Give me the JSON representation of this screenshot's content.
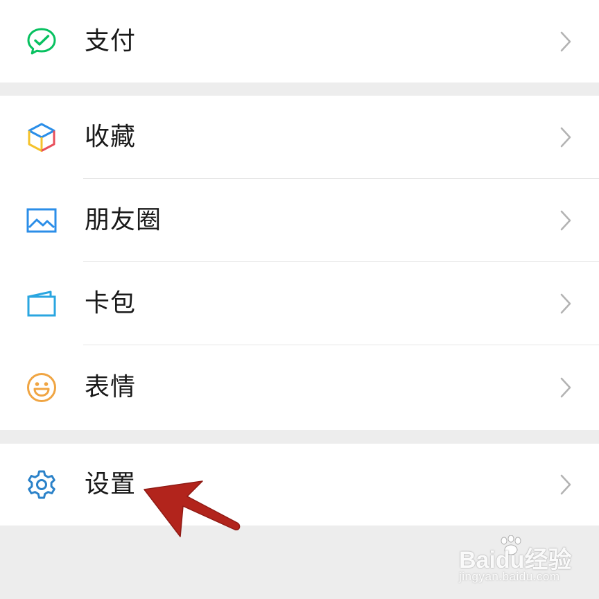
{
  "menu_groups": [
    {
      "items": [
        {
          "label": "支付",
          "icon": "wechat-pay-icon"
        }
      ]
    },
    {
      "items": [
        {
          "label": "收藏",
          "icon": "favorites-cube-icon"
        },
        {
          "label": "朋友圈",
          "icon": "moments-picture-icon"
        },
        {
          "label": "卡包",
          "icon": "card-wallet-icon"
        },
        {
          "label": "表情",
          "icon": "sticker-smile-icon"
        }
      ]
    },
    {
      "items": [
        {
          "label": "设置",
          "icon": "gear-icon"
        }
      ]
    }
  ],
  "colors": {
    "background": "#ededed",
    "row_background": "#ffffff",
    "label_text": "#1a1a1a",
    "chevron": "#b3b3b3",
    "pay_green": "#07c160",
    "picture_blue": "#2b8ee8",
    "wallet_blue": "#2aa6e0",
    "smile_orange": "#f0a543",
    "gear_blue": "#2b82c9",
    "annotation_arrow": "#b2241c"
  },
  "annotation": {
    "icon": "red-pointer-arrow-icon"
  },
  "watermark": {
    "brand": "Baidu经验",
    "url": "jingyan.baidu.com"
  }
}
